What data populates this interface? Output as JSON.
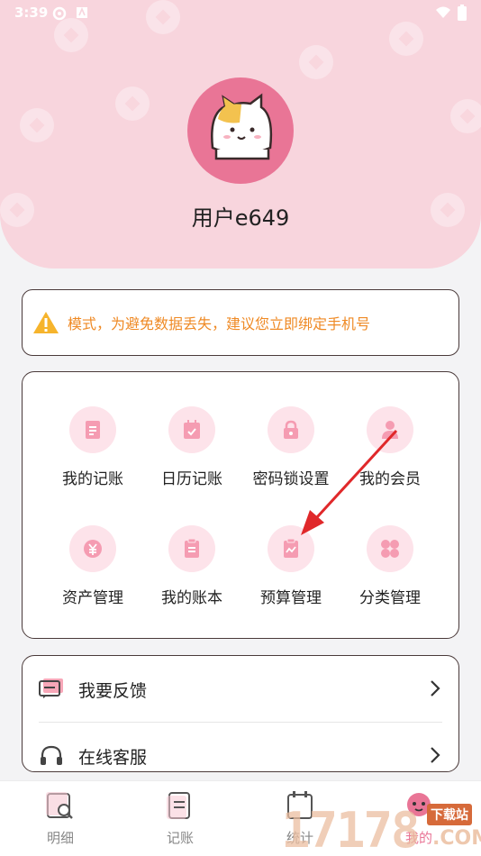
{
  "status_bar": {
    "time": "3:39"
  },
  "header": {
    "username": "用户e649"
  },
  "notice": {
    "text": "模式，为避免数据丢失，建议您立即绑定手机号"
  },
  "features": [
    {
      "label": "我的记账",
      "icon": "ledger-icon"
    },
    {
      "label": "日历记账",
      "icon": "calendar-icon"
    },
    {
      "label": "密码锁设置",
      "icon": "lock-icon"
    },
    {
      "label": "我的会员",
      "icon": "member-icon"
    },
    {
      "label": "资产管理",
      "icon": "asset-icon"
    },
    {
      "label": "我的账本",
      "icon": "book-icon"
    },
    {
      "label": "预算管理",
      "icon": "budget-icon"
    },
    {
      "label": "分类管理",
      "icon": "category-icon"
    }
  ],
  "menu": [
    {
      "label": "我要反馈",
      "icon": "feedback-icon"
    },
    {
      "label": "在线客服",
      "icon": "headset-icon"
    }
  ],
  "tabs": [
    {
      "label": "明细"
    },
    {
      "label": "记账"
    },
    {
      "label": "统计"
    },
    {
      "label": "我的"
    }
  ],
  "watermark": {
    "digits": "17178",
    "site": "下载站",
    "domain": ".COM"
  },
  "colors": {
    "header_bg": "#f8d5dd",
    "accent_pink": "#e97596",
    "icon_bg": "#fde3ea",
    "warning_orange": "#ef8a25",
    "arrow_red": "#e0282a"
  }
}
